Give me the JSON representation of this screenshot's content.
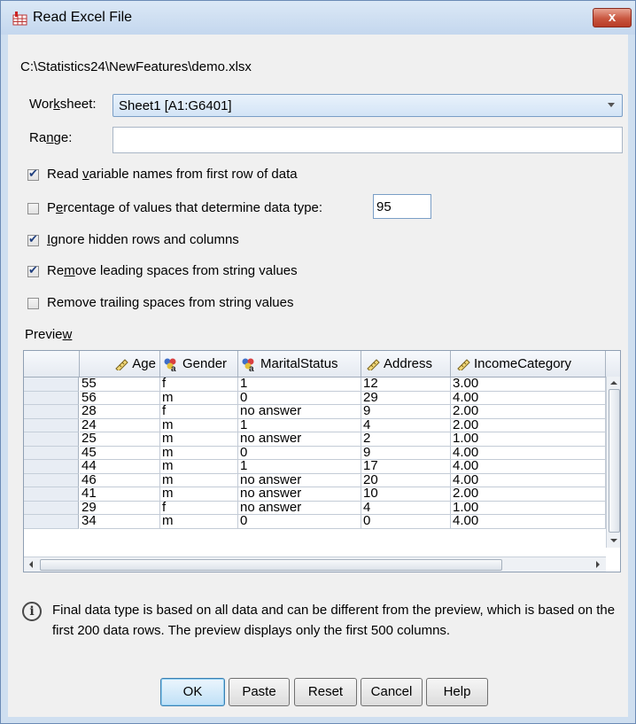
{
  "window": {
    "title": "Read Excel File",
    "close_label": "x",
    "title_icon": "spss-data-icon"
  },
  "file_path": "C:\\Statistics24\\NewFeatures\\demo.xlsx",
  "worksheet": {
    "label_pre": "Wor",
    "label_ul": "k",
    "label_post": "sheet:",
    "value": "Sheet1 [A1:G6401]"
  },
  "range": {
    "label_pre": "Ra",
    "label_ul": "n",
    "label_post": "ge:",
    "value": ""
  },
  "options": [
    {
      "pre": "Read ",
      "ul": "v",
      "post": "ariable names from first row of data",
      "checked": true
    },
    {
      "pre": "P",
      "ul": "e",
      "post": "rcentage of values that determine data type:",
      "checked": false
    },
    {
      "pre": "",
      "ul": "I",
      "post": "gnore hidden rows and columns",
      "checked": true
    },
    {
      "pre": "Re",
      "ul": "m",
      "post": "ove leading spaces from string values",
      "checked": true
    },
    {
      "pre": "Remove trailin",
      "ul": "g",
      "post": " spaces from string values",
      "checked": false
    }
  ],
  "percentage_value": "95",
  "preview": {
    "label_pre": "Previe",
    "label_ul": "w",
    "label_post": "",
    "columns": [
      {
        "name": "Age",
        "icon": "scale-ruler-icon"
      },
      {
        "name": "Gender",
        "icon": "nominal-string-icon"
      },
      {
        "name": "MaritalStatus",
        "icon": "nominal-string-icon"
      },
      {
        "name": "Address",
        "icon": "scale-ruler-icon"
      },
      {
        "name": "IncomeCategory",
        "icon": "scale-ruler-icon"
      }
    ],
    "rows": [
      [
        "55",
        "f",
        "1",
        "12",
        "3.00"
      ],
      [
        "56",
        "m",
        "0",
        "29",
        "4.00"
      ],
      [
        "28",
        "f",
        "no answer",
        "9",
        "2.00"
      ],
      [
        "24",
        "m",
        "1",
        "4",
        "2.00"
      ],
      [
        "25",
        "m",
        "no answer",
        "2",
        "1.00"
      ],
      [
        "45",
        "m",
        "0",
        "9",
        "4.00"
      ],
      [
        "44",
        "m",
        "1",
        "17",
        "4.00"
      ],
      [
        "46",
        "m",
        "no answer",
        "20",
        "4.00"
      ],
      [
        "41",
        "m",
        "no answer",
        "10",
        "2.00"
      ],
      [
        "29",
        "f",
        "no answer",
        "4",
        "1.00"
      ],
      [
        "34",
        "m",
        "0",
        "0",
        "4.00"
      ]
    ]
  },
  "info_text": "Final data type is based on all data and can be different from the preview, which is based on the first 200 data rows. The preview displays only the first 500 columns.",
  "buttons": {
    "ok": "OK",
    "paste": "Paste",
    "reset": "Reset",
    "cancel": "Cancel",
    "help": "Help"
  }
}
